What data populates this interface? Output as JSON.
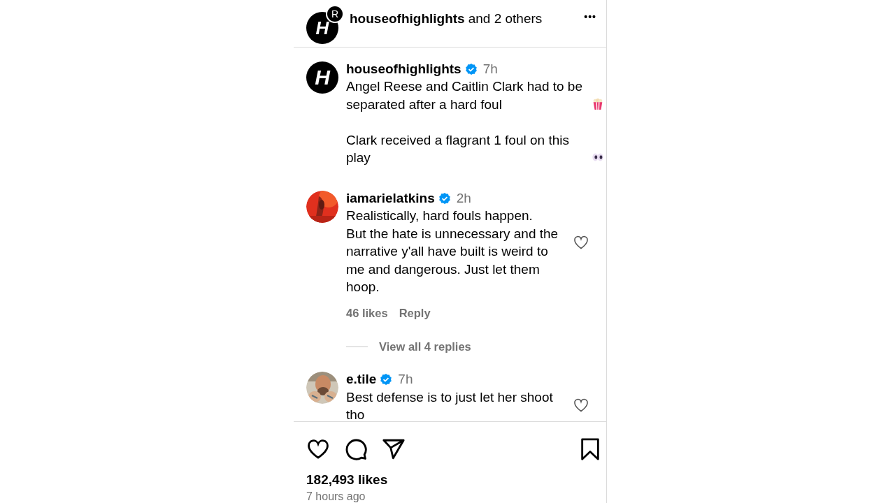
{
  "header": {
    "avatar": {
      "main": "H",
      "badge": "R"
    },
    "user": "houseofhighlights",
    "others": "and 2 others",
    "menu": "•••"
  },
  "post": {
    "avatar": "H",
    "user": "houseofhighlights",
    "verified": true,
    "time": "7h",
    "paragraphs": [
      {
        "text": "Angel Reese and Caitlin Clark had to be separated after a hard foul",
        "kind": "popcorn"
      },
      {
        "text": "Clark received a flagrant 1 foul on this play",
        "kind": "eyes"
      }
    ]
  },
  "comments": [
    {
      "user": "iamarielatkins",
      "verified": true,
      "time": "2h",
      "text": "Realistically, hard fouls happen.\nBut the hate is unnecessary and the narrative y'all have built is weird to me and dangerous. Just let them hoop.",
      "liked": false,
      "likes": "46 likes",
      "reply": "Reply",
      "view_replies": "View all 4 replies"
    },
    {
      "user": "e.tile",
      "verified": true,
      "time": "7h",
      "text": "Best defense is to just let her shoot tho",
      "liked": false
    }
  ],
  "actions": {
    "liked": false,
    "saved": false
  },
  "likes": "182,493 likes",
  "time_ago": "7 hours ago"
}
